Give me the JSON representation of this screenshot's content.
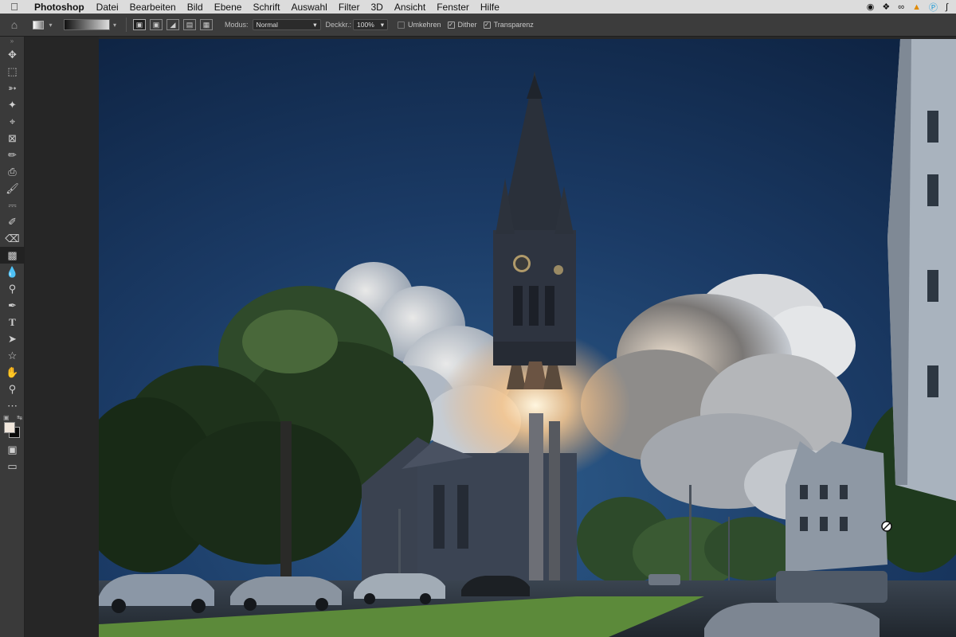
{
  "menubar": {
    "apple_icon": "apple-icon",
    "app_name": "Photoshop",
    "items": [
      "Datei",
      "Bearbeiten",
      "Bild",
      "Ebene",
      "Schrift",
      "Auswahl",
      "Filter",
      "3D",
      "Ansicht",
      "Fenster",
      "Hilfe"
    ],
    "tray_icons": [
      "record-icon",
      "dropbox-icon",
      "creative-cloud-icon",
      "vlc-icon",
      "skype-icon",
      "bluetooth-icon"
    ]
  },
  "options_bar": {
    "mode_label": "Modus:",
    "mode_value": "Normal",
    "opacity_label": "Deckkr.:",
    "opacity_value": "100%",
    "reverse_label": "Umkehren",
    "reverse_checked": false,
    "dither_label": "Dither",
    "dither_checked": true,
    "transparency_label": "Transparenz",
    "transparency_checked": true,
    "gradient_types": [
      "linear-gradient-icon",
      "radial-gradient-icon",
      "angle-gradient-icon",
      "reflected-gradient-icon",
      "diamond-gradient-icon"
    ]
  },
  "toolbar": {
    "active_tool": "gradient-tool",
    "tools": [
      "move-tool",
      "marquee-tool",
      "lasso-tool",
      "magic-wand-tool",
      "crop-tool",
      "frame-tool",
      "eyedropper-tool",
      "healing-brush-tool",
      "brush-tool",
      "clone-stamp-tool",
      "history-brush-tool",
      "eraser-tool",
      "gradient-tool",
      "blur-tool",
      "dodge-tool",
      "pen-tool",
      "type-tool",
      "path-selection-tool",
      "shape-tool",
      "hand-tool",
      "zoom-tool",
      "more-tools"
    ],
    "foreground_color": "#f1e7dc",
    "background_color": "#0b0b0b"
  },
  "canvas": {
    "content": "photo-composite-church-rocket-launch"
  },
  "colors": {
    "menubar_bg": "#dcdcdc",
    "options_bg": "#3c3c3c",
    "toolbar_bg": "#3a3a3a",
    "workspace_bg": "#262626"
  }
}
